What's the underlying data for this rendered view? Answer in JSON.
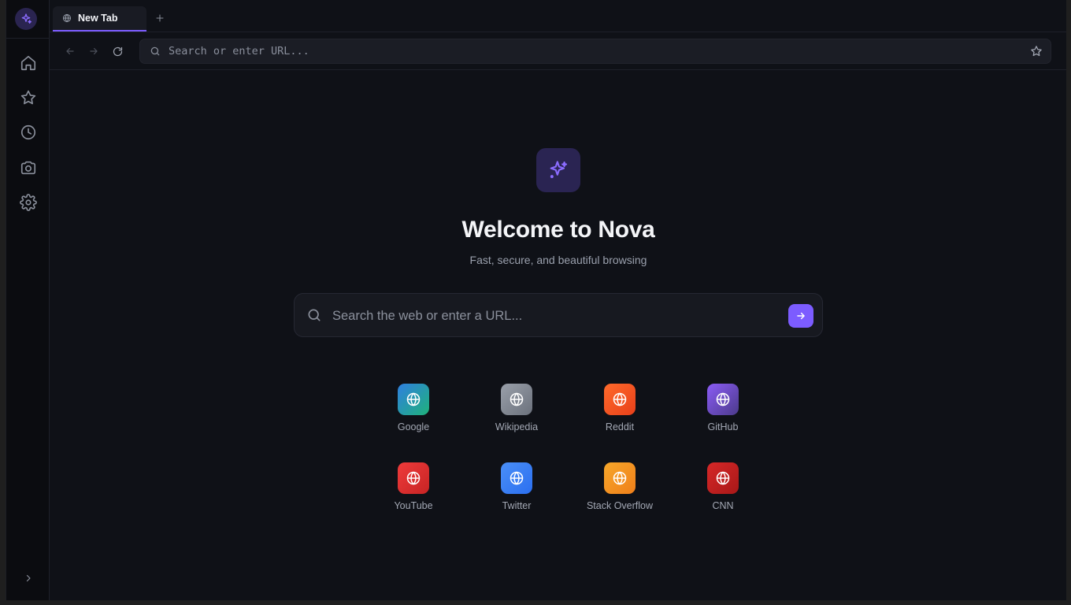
{
  "sidebar": {
    "logo_icon": "sparkles-icon",
    "items": [
      {
        "icon": "home-icon"
      },
      {
        "icon": "star-icon"
      },
      {
        "icon": "history-icon"
      },
      {
        "icon": "camera-icon"
      },
      {
        "icon": "settings-icon"
      }
    ],
    "collapse_icon": "chevron-right-icon"
  },
  "tabs": [
    {
      "title": "New Tab",
      "icon": "globe-icon",
      "active": true
    }
  ],
  "toolbar": {
    "url_placeholder": "Search or enter URL...",
    "url_value": ""
  },
  "newtab": {
    "title": "Welcome to Nova",
    "subtitle": "Fast, secure, and beautiful browsing",
    "search_placeholder": "Search the web or enter a URL...",
    "quick_links": [
      {
        "label": "Google",
        "colors": [
          "#2f7fe0",
          "#1fb27a"
        ]
      },
      {
        "label": "Wikipedia",
        "colors": [
          "#9aa0aa",
          "#6b717c"
        ]
      },
      {
        "label": "Reddit",
        "colors": [
          "#ff6a2b",
          "#e8401a"
        ]
      },
      {
        "label": "GitHub",
        "colors": [
          "#8b5cf6",
          "#4b3a8a"
        ]
      },
      {
        "label": "YouTube",
        "colors": [
          "#ef3b3b",
          "#c72424"
        ]
      },
      {
        "label": "Twitter",
        "colors": [
          "#4a8ff7",
          "#2b6ff0"
        ]
      },
      {
        "label": "Stack Overflow",
        "colors": [
          "#f7a72a",
          "#ef7f1a"
        ]
      },
      {
        "label": "CNN",
        "colors": [
          "#d62828",
          "#a81818"
        ]
      }
    ]
  },
  "colors": {
    "accent": "#7c5cff",
    "background": "#0f1117"
  }
}
